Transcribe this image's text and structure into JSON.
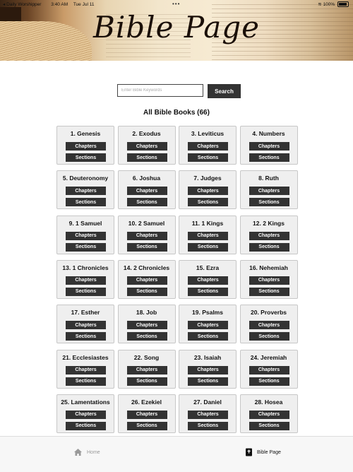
{
  "status": {
    "app": "Daily Worshipper",
    "time": "3:40 AM",
    "date": "Tue Jul 11",
    "battery": "100%",
    "multitask": "•••"
  },
  "banner": {
    "title": "Bible Page"
  },
  "search": {
    "placeholder": "Enter Bible Keywords",
    "button": "Search"
  },
  "heading": "All Bible Books (66)",
  "buttons": {
    "chapters": "Chapters",
    "sections": "Sections"
  },
  "books": [
    "1. Genesis",
    "2. Exodus",
    "3. Leviticus",
    "4. Numbers",
    "5. Deuteronomy",
    "6. Joshua",
    "7. Judges",
    "8. Ruth",
    "9. 1 Samuel",
    "10. 2 Samuel",
    "11. 1 Kings",
    "12. 2 Kings",
    "13. 1 Chronicles",
    "14. 2 Chronicles",
    "15. Ezra",
    "16. Nehemiah",
    "17. Esther",
    "18. Job",
    "19. Psalms",
    "20. Proverbs",
    "21. Ecclesiastes",
    "22. Song",
    "23. Isaiah",
    "24. Jeremiah",
    "25. Lamentations",
    "26. Ezekiel",
    "27. Daniel",
    "28. Hosea"
  ],
  "tabs": {
    "home": "Home",
    "bible": "Bible Page"
  },
  "colors": {
    "button": "#333333",
    "card": "#efefef",
    "inactive_tab": "#9a9a9a"
  }
}
